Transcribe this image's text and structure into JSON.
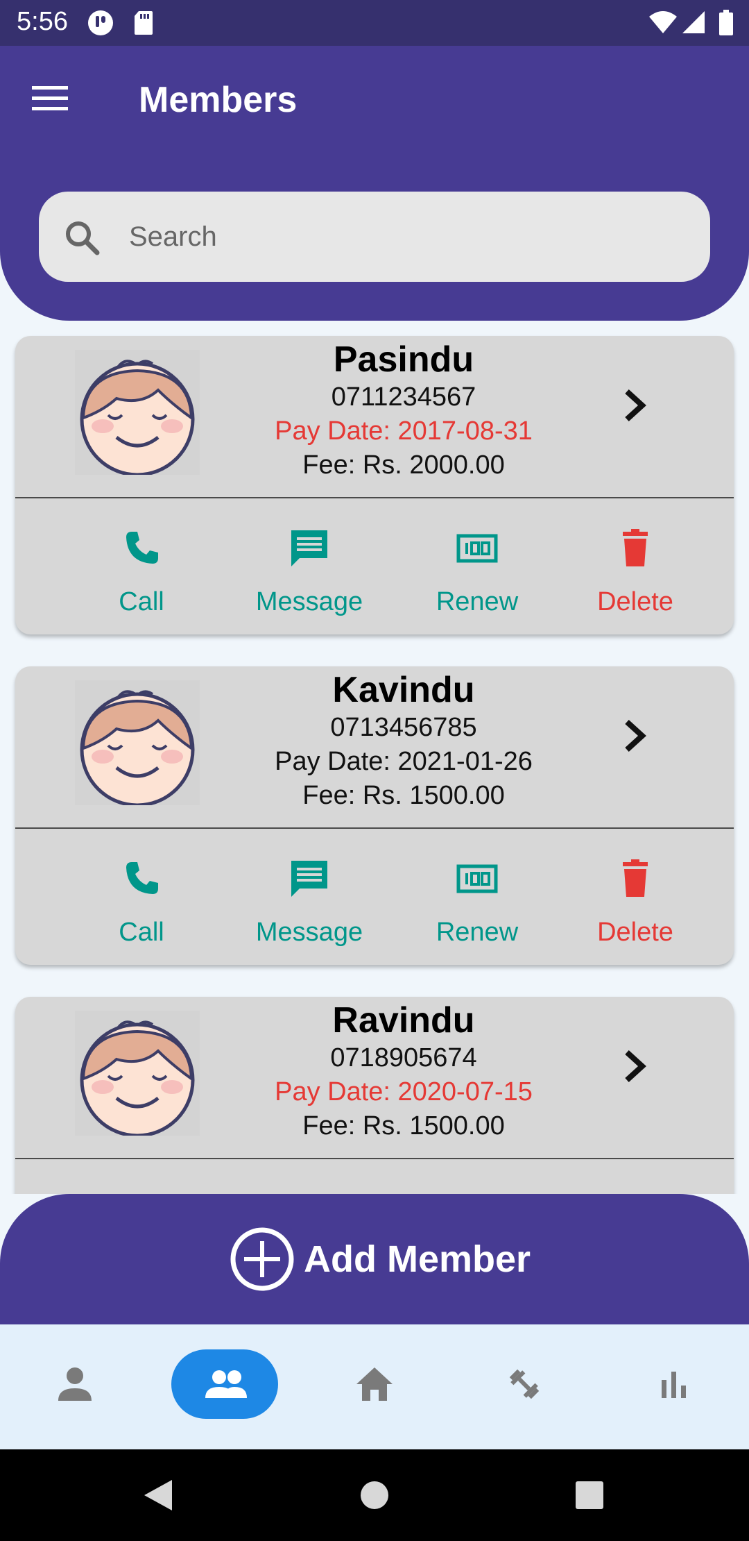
{
  "status_bar": {
    "time": "5:56"
  },
  "header": {
    "title": "Members",
    "menu_icon": "menu-icon"
  },
  "search": {
    "placeholder": "Search",
    "value": ""
  },
  "members": [
    {
      "name": "Pasindu",
      "phone": "0711234567",
      "pay_date": "Pay Date: 2017-08-31",
      "fee": "Fee: Rs. 2000.00",
      "overdue": true
    },
    {
      "name": "Kavindu",
      "phone": "0713456785",
      "pay_date": "Pay Date: 2021-01-26",
      "fee": "Fee: Rs. 1500.00",
      "overdue": false
    },
    {
      "name": "Ravindu",
      "phone": "0718905674",
      "pay_date": "Pay Date: 2020-07-15",
      "fee": "Fee: Rs. 1500.00",
      "overdue": true
    }
  ],
  "actions": {
    "call": "Call",
    "message": "Message",
    "renew": "Renew",
    "delete": "Delete"
  },
  "add_member": {
    "label": "Add Member"
  },
  "bottom_nav": [
    {
      "name": "profile",
      "icon": "person-icon",
      "active": false
    },
    {
      "name": "members",
      "icon": "group-icon",
      "active": true
    },
    {
      "name": "home",
      "icon": "home-icon",
      "active": false
    },
    {
      "name": "workouts",
      "icon": "dumbbell-icon",
      "active": false
    },
    {
      "name": "stats",
      "icon": "bar-chart-icon",
      "active": false
    }
  ],
  "colors": {
    "primary": "#473b93",
    "status_bar": "#36306e",
    "accent_teal": "#00968a",
    "danger": "#e53935",
    "nav_active": "#1e88e5",
    "card_bg": "#d7d7d7"
  }
}
